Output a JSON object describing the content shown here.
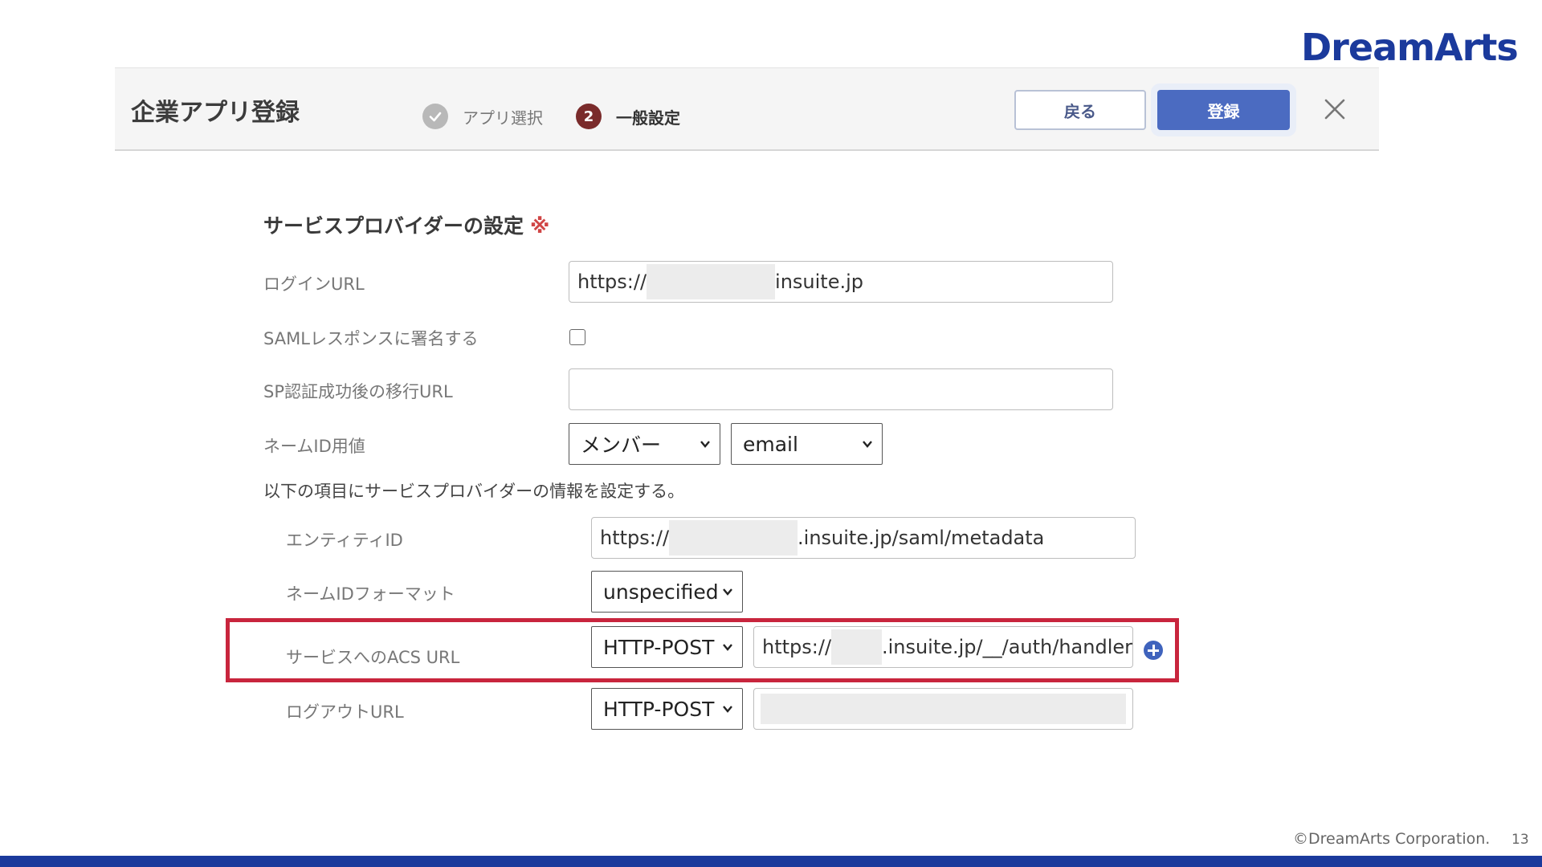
{
  "brand": {
    "logo_text": "DreamArts",
    "color": "#1b3a9c"
  },
  "header": {
    "title": "企業アプリ登録",
    "steps": [
      {
        "icon": "check-icon",
        "label": "アプリ選択",
        "state": "done"
      },
      {
        "number": "2",
        "label": "一般設定",
        "state": "active"
      }
    ],
    "back_label": "戻る",
    "register_label": "登録",
    "close_icon": "close-icon"
  },
  "form": {
    "section_title": "サービスプロバイダーの設定",
    "required_mark": "※",
    "login_url": {
      "label": "ログインURL",
      "prefix": "https://",
      "suffix": "insuite.jp"
    },
    "saml_sign": {
      "label": "SAMLレスポンスに署名する",
      "checked": false
    },
    "sp_redirect": {
      "label": "SP認証成功後の移行URL",
      "value": ""
    },
    "name_id": {
      "label": "ネームID用値",
      "select1": "メンバー",
      "select2": "email"
    },
    "note": "以下の項目にサービスプロバイダーの情報を設定する。",
    "entity_id": {
      "label": "エンティティID",
      "prefix": "https://",
      "suffix": ".insuite.jp/saml/metadata"
    },
    "name_id_format": {
      "label": "ネームIDフォーマット",
      "value": "unspecified"
    },
    "acs_url": {
      "label": "サービスへのACS URL",
      "binding": "HTTP-POST",
      "prefix": "https://",
      "suffix": ".insuite.jp/__/auth/handler"
    },
    "logout_url": {
      "label": "ログアウトURL",
      "binding": "HTTP-POST",
      "value": ""
    }
  },
  "highlight_color": "#c8253d",
  "footer": {
    "copyright": "©DreamArts Corporation.",
    "page": "13"
  }
}
